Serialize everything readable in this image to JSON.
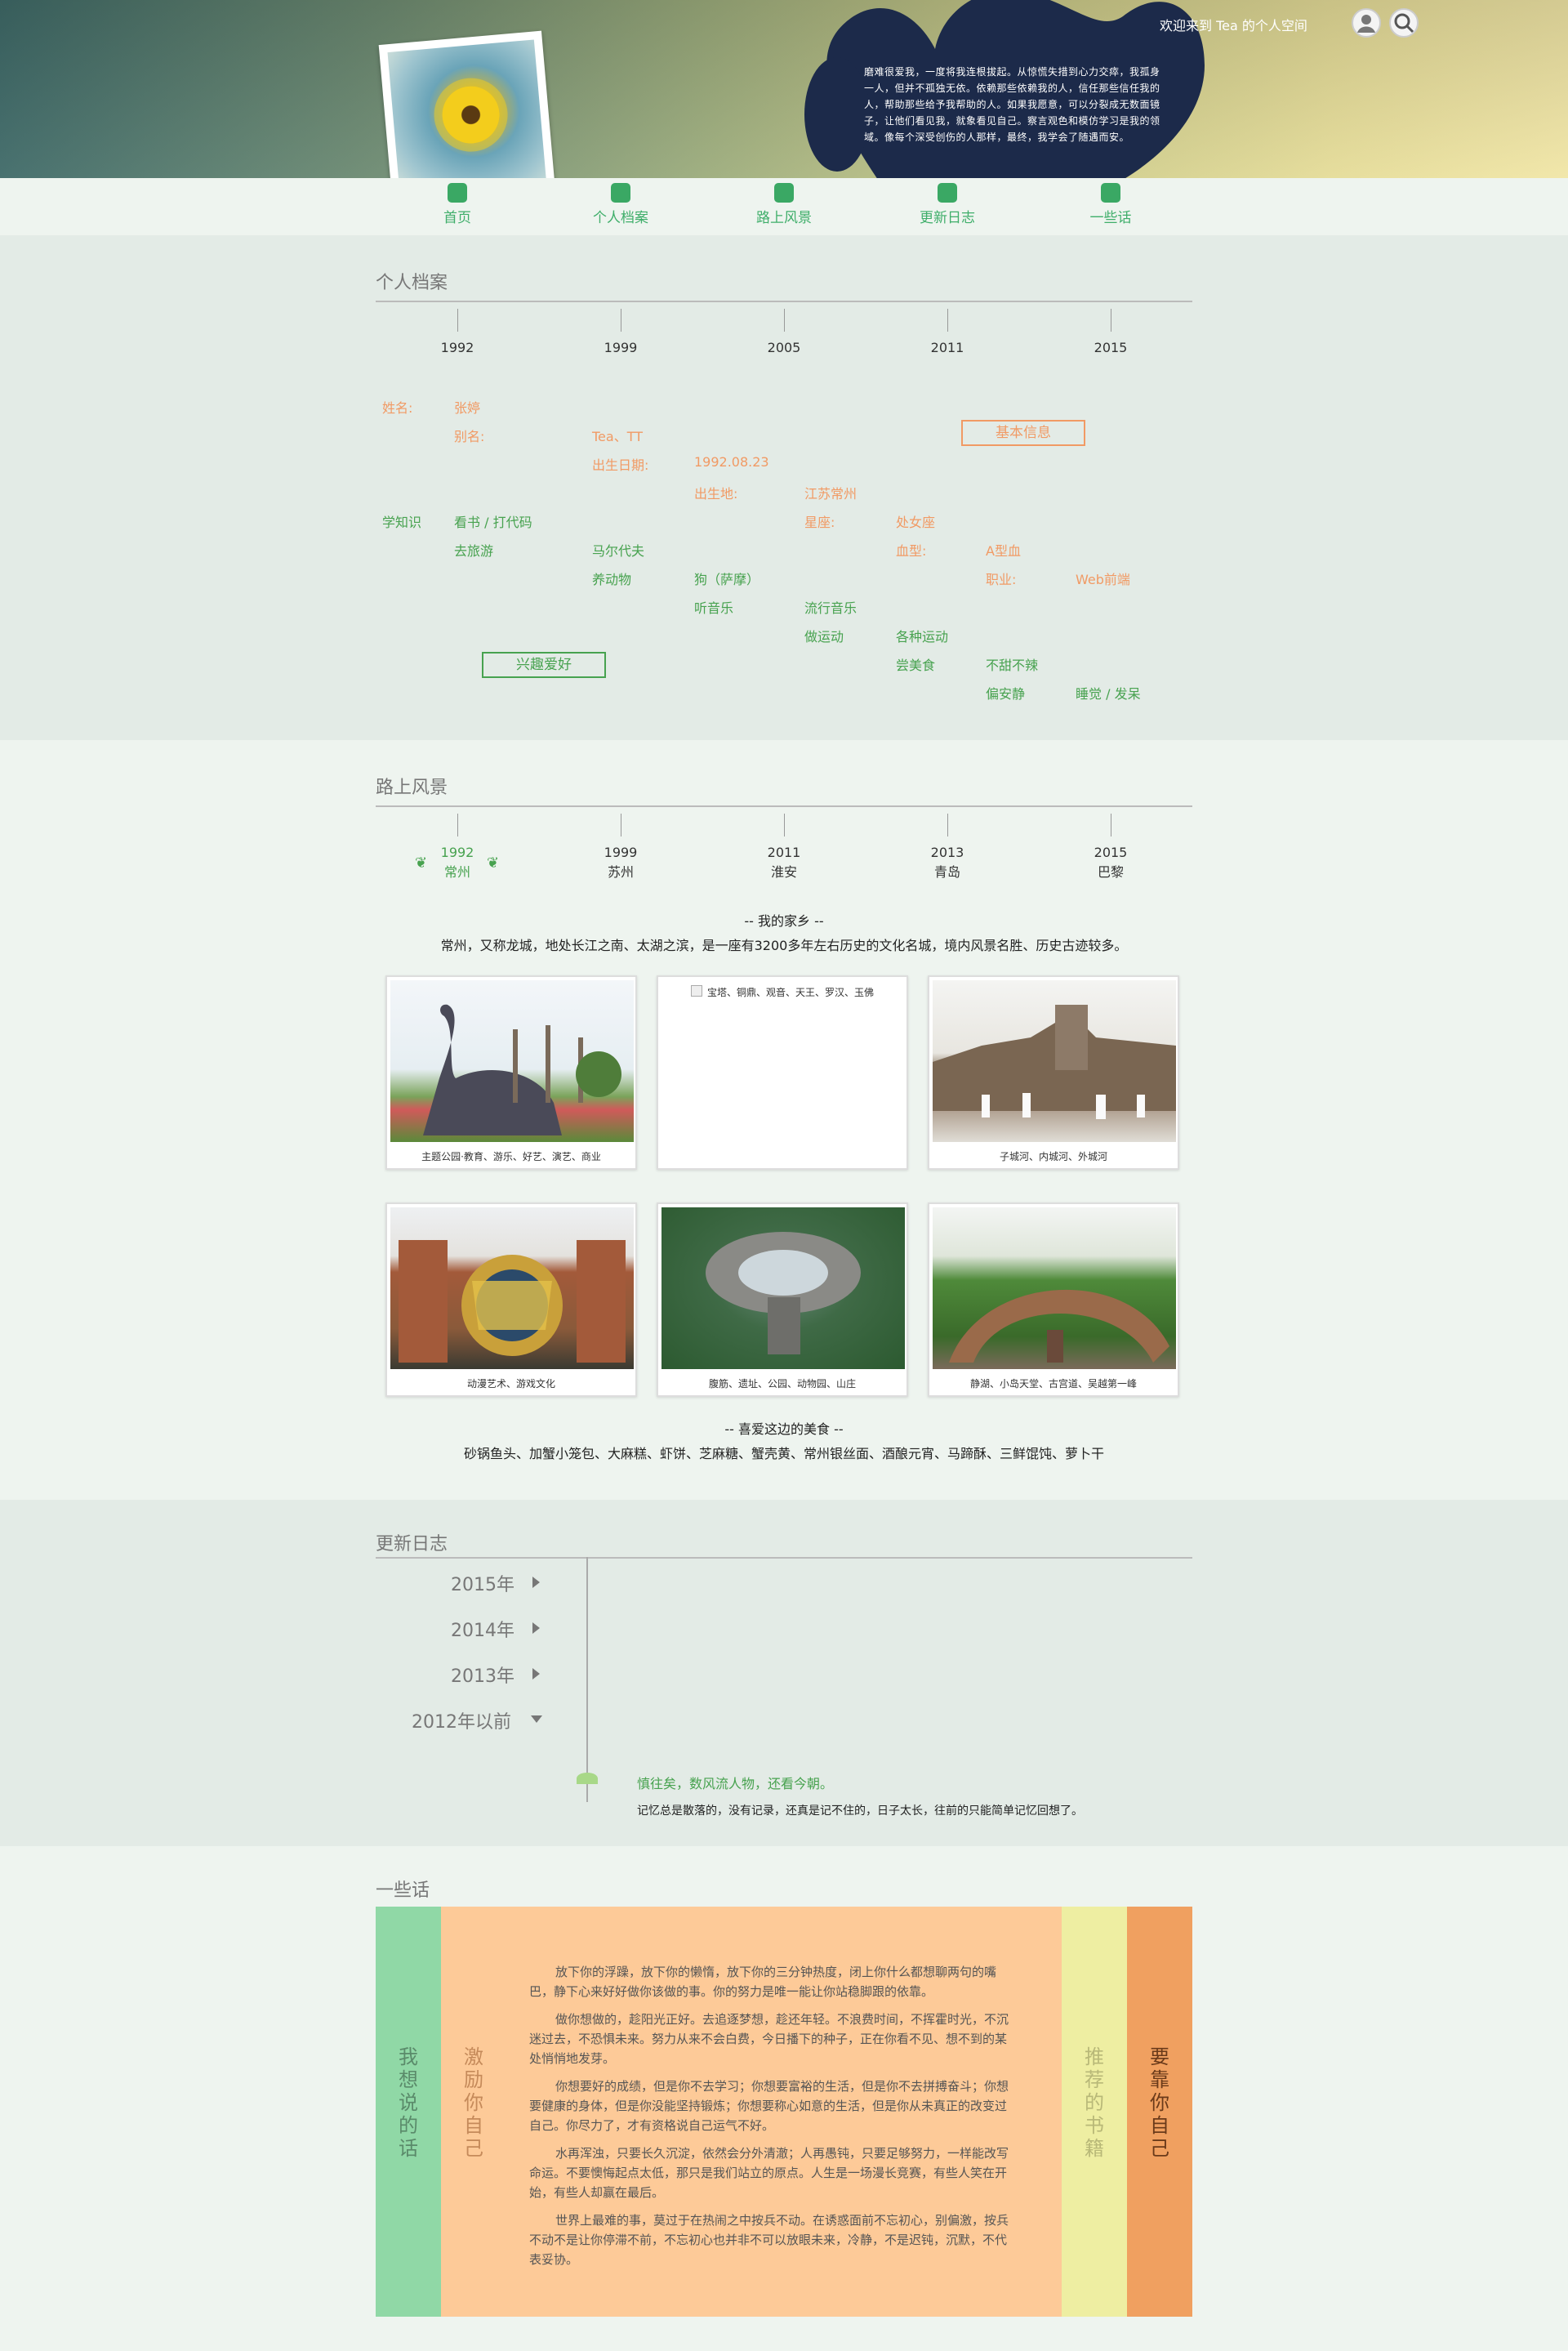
{
  "header": {
    "welcome": "欢迎来到 Tea 的个人空间",
    "quote": "磨难很爱我，一度将我连根拔起。从惊慌失措到心力交瘁，我孤身一人，但并不孤独无依。依赖那些依赖我的人，信任那些信任我的人，帮助那些给予我帮助的人。如果我愿意，可以分裂成无数面镜子，让他们看见我，就象看见自己。察言观色和模仿学习是我的领域。像每个深受创伤的人那样，最终，我学会了随遇而安。",
    "icons": {
      "user": "user-icon",
      "search": "search-icon"
    }
  },
  "nav": [
    {
      "label": "首页",
      "icon": "home-icon"
    },
    {
      "label": "个人档案",
      "icon": "profile-icon"
    },
    {
      "label": "路上风景",
      "icon": "scenery-icon"
    },
    {
      "label": "更新日志",
      "icon": "log-icon"
    },
    {
      "label": "一些话",
      "icon": "chat-icon"
    }
  ],
  "profile": {
    "title": "个人档案",
    "years": [
      "1992",
      "1999",
      "2005",
      "2011",
      "2015"
    ],
    "basic": {
      "box_label": "基本信息",
      "name_label": "姓名:",
      "name": "张婷",
      "alias_label": "别名:",
      "alias": "Tea、TT",
      "birth_label": "出生日期:",
      "birth": "1992.08.23",
      "place_label": "出生地:",
      "place": "江苏常州",
      "star_label": "星座:",
      "star": "处女座",
      "blood_label": "血型:",
      "blood": "A型血",
      "job_label": "职业:",
      "job": "Web前端"
    },
    "hobby": {
      "box_label": "兴趣爱好",
      "learn": "学知识",
      "items": [
        "看书 / 打代码",
        "去旅游",
        "马尔代夫",
        "养动物",
        "狗（萨摩）",
        "听音乐",
        "流行音乐",
        "做运动",
        "各种运动",
        "尝美食",
        "不甜不辣",
        "偏安静",
        "睡觉 / 发呆"
      ]
    }
  },
  "scenery": {
    "title": "路上风景",
    "stops": [
      {
        "year": "1992",
        "city": "常州"
      },
      {
        "year": "1999",
        "city": "苏州"
      },
      {
        "year": "2011",
        "city": "淮安"
      },
      {
        "year": "2013",
        "city": "青岛"
      },
      {
        "year": "2015",
        "city": "巴黎"
      }
    ],
    "hometown_title": "-- 我的家乡 --",
    "hometown_desc": "常州，又称龙城，地处长江之南、太湖之滨，是一座有3200多年左右历史的文化名城，境内风景名胜、历史古迹较多。",
    "cards": [
      {
        "caption": "主题公园·教育、游乐、好艺、演艺、商业"
      },
      {
        "caption": "宝塔、铜鼎、观音、天王、罗汉、玉佛"
      },
      {
        "caption": "子城河、内城河、外城河"
      },
      {
        "caption": "动漫艺术、游戏文化"
      },
      {
        "caption": "腹筋、遗址、公园、动物园、山庄"
      },
      {
        "caption": "静湖、小岛天堂、古宫道、吴越第一峰"
      }
    ],
    "food_title": "-- 喜爱这边的美食 --",
    "food_list": "砂锅鱼头、加蟹小笼包、大麻糕、虾饼、芝麻糖、蟹壳黄、常州银丝面、酒酿元宵、马蹄酥、三鲜馄饨、萝卜干"
  },
  "changelog": {
    "title": "更新日志",
    "years": [
      "2015年",
      "2014年",
      "2013年",
      "2012年以前"
    ],
    "entry_title": "慎往矣，数风流人物，还看今朝。",
    "entry_text": "记忆总是散落的，没有记录，还真是记不住的，日子太长，往前的只能简单记忆回想了。"
  },
  "words": {
    "title": "一些话",
    "tab1": "我想说的话",
    "tab2": "激励你自己",
    "tab3": "推荐的书籍",
    "tab4": "要靠你自己",
    "paragraphs": [
      "放下你的浮躁，放下你的懒惰，放下你的三分钟热度，闭上你什么都想聊两句的嘴巴，静下心来好好做你该做的事。你的努力是唯一能让你站稳脚跟的依靠。",
      "做你想做的，趁阳光正好。去追逐梦想，趁还年轻。不浪费时间，不挥霍时光，不沉迷过去，不恐惧未来。努力从来不会白费，今日播下的种子，正在你看不见、想不到的某处悄悄地发芽。",
      "你想要好的成绩，但是你不去学习；你想要富裕的生活，但是你不去拼搏奋斗；你想要健康的身体，但是你没能坚持锻炼；你想要称心如意的生活，但是你从未真正的改变过自己。你尽力了，才有资格说自己运气不好。",
      "水再浑浊，只要长久沉淀，依然会分外清澈；人再愚钝，只要足够努力，一样能改写命运。不要懊悔起点太低，那只是我们站立的原点。人生是一场漫长竞赛，有些人笑在开始，有些人却赢在最后。",
      "世界上最难的事，莫过于在热闹之中按兵不动。在诱惑面前不忘初心，别偏激，按兵不动不是让你停滞不前，不忘初心也并非不可以放眼未来，冷静，不是迟钝，沉默，不代表妥协。"
    ]
  },
  "colors": {
    "accent_green": "#3fae6a",
    "orange": "#f19a64",
    "green_text": "#47a24f",
    "col_green": "#90d8a6",
    "col_peach": "#fdca98",
    "col_yellow": "#eeeea2",
    "col_orange": "#f0a060"
  }
}
